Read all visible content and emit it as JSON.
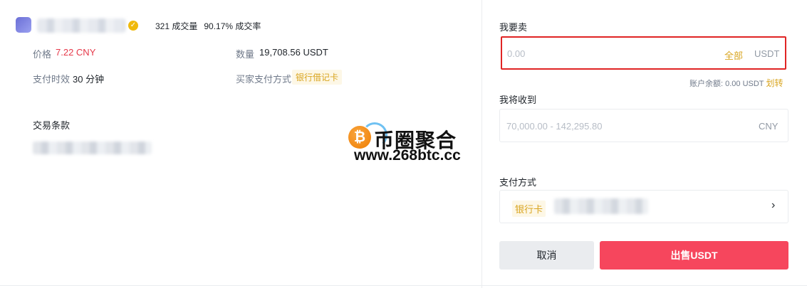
{
  "merchant": {
    "trade_count": "321 成交量",
    "completion_rate": "90.17% 成交率"
  },
  "details": {
    "price_label": "价格",
    "price_value": "7.22 CNY",
    "quantity_label": "数量",
    "quantity_value": "19,708.56 USDT",
    "pay_time_label": "支付时效",
    "pay_time_value": "30 分钟",
    "buyer_payment_label": "买家支付方式",
    "buyer_payment_value": "银行借记卡"
  },
  "terms": {
    "title": "交易条款"
  },
  "watermark": {
    "coin_symbol": "₿",
    "title": "币圈聚合",
    "url": "www.268btc.cc"
  },
  "sell_form": {
    "sell_label": "我要卖",
    "sell_placeholder": "0.00",
    "all_label": "全部",
    "sell_unit": "USDT",
    "balance_text": "账户余额: 0.00 USDT",
    "transfer_label": "划转",
    "receive_label": "我将收到",
    "receive_placeholder": "70,000.00 - 142,295.80",
    "receive_unit": "CNY",
    "payment_label": "支付方式",
    "payment_method": "银行卡",
    "cancel_label": "取消",
    "sell_button_label": "出售USDT"
  },
  "colors": {
    "accent_gold": "#d9a520",
    "price_red": "#e6394a",
    "sell_button": "#f6465d",
    "error_border": "#e02424"
  }
}
